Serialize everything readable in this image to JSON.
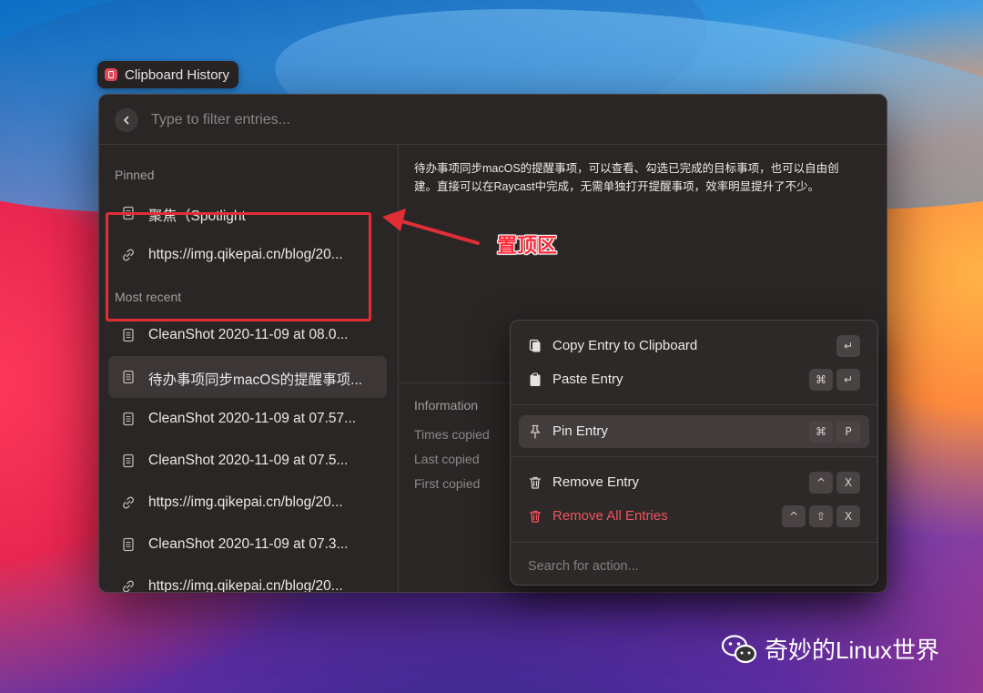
{
  "app": {
    "tag_title": "Clipboard History",
    "search_placeholder": "Type to filter entries..."
  },
  "sidebar": {
    "pinned_title": "Pinned",
    "pinned": [
      {
        "icon": "document-icon",
        "label": "聚焦（Spotlight"
      },
      {
        "icon": "link-icon",
        "label": "https://img.qikepai.cn/blog/20..."
      }
    ],
    "recent_title": "Most recent",
    "recent": [
      {
        "icon": "document-icon",
        "label": "CleanShot 2020-11-09 at 08.0..."
      },
      {
        "icon": "document-icon",
        "label": "待办事项同步macOS的提醒事项..."
      },
      {
        "icon": "document-icon",
        "label": "CleanShot 2020-11-09 at 07.57..."
      },
      {
        "icon": "document-icon",
        "label": "CleanShot 2020-11-09 at 07.5..."
      },
      {
        "icon": "link-icon",
        "label": "https://img.qikepai.cn/blog/20..."
      },
      {
        "icon": "document-icon",
        "label": "CleanShot 2020-11-09 at 07.3..."
      },
      {
        "icon": "link-icon",
        "label": "https://img.qikepai.cn/blog/20..."
      }
    ]
  },
  "detail": {
    "text": "待办事项同步macOS的提醒事项，可以查看、勾选已完成的目标事项，也可以自由创建。直接可以在Raycast中完成，无需单独打开提醒事项，效率明显提升了不少。",
    "info_title": "Information",
    "info_rows": [
      "Times copied",
      "Last copied",
      "First copied"
    ]
  },
  "actions": {
    "copy": {
      "label": "Copy Entry to Clipboard",
      "keys": [
        "↵"
      ]
    },
    "paste": {
      "label": "Paste Entry",
      "keys": [
        "⌘",
        "↵"
      ]
    },
    "pin": {
      "label": "Pin Entry",
      "keys": [
        "⌘",
        "P"
      ]
    },
    "remove": {
      "label": "Remove Entry",
      "keys": [
        "^",
        "X"
      ]
    },
    "remove_all": {
      "label": "Remove All Entries",
      "keys": [
        "^",
        "⇧",
        "X"
      ]
    },
    "search_placeholder": "Search for action..."
  },
  "annotation": {
    "label": "置顶区",
    "color": "#ff2a3a"
  },
  "watermark": {
    "label": "奇妙的Linux世界"
  },
  "colors": {
    "accent_red": "#e02e36",
    "danger": "#f0535b",
    "window_bg": "#2b2626"
  }
}
